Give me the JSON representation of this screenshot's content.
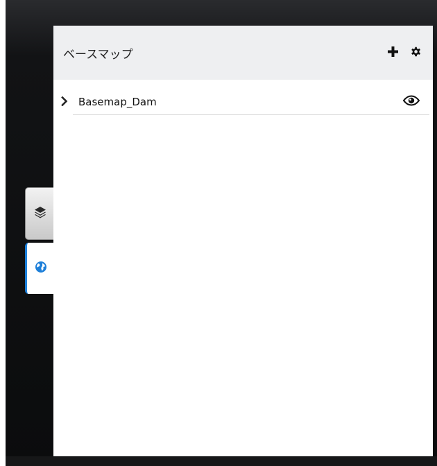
{
  "panel": {
    "title": "ベースマップ",
    "actions": [
      {
        "icon": "plus-icon"
      },
      {
        "icon": "gear-icon"
      }
    ]
  },
  "layers": [
    {
      "name": "Basemap_Dam",
      "expanded": false,
      "visible": true
    }
  ],
  "side_tabs": [
    {
      "icon": "layers-icon",
      "active": false
    },
    {
      "icon": "globe-icon",
      "active": true
    }
  ],
  "colors": {
    "accent": "#1d7fd9",
    "header_bg": "#eeeff1",
    "app_bg": "#0b0c0d"
  }
}
